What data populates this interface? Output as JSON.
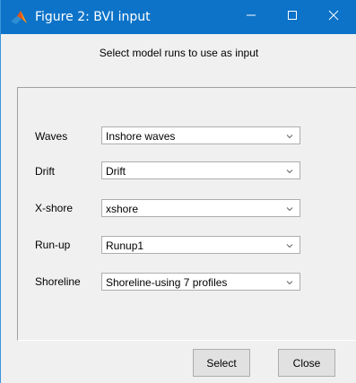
{
  "window": {
    "title": "Figure 2: BVI input"
  },
  "header": {
    "instruction": "Select model runs to use as input"
  },
  "rows": [
    {
      "label": "Waves",
      "value": "Inshore waves"
    },
    {
      "label": "Drift",
      "value": "Drift"
    },
    {
      "label": "X-shore",
      "value": "xshore"
    },
    {
      "label": "Run-up",
      "value": "Runup1"
    },
    {
      "label": "Shoreline",
      "value": "Shoreline-using 7 profiles"
    }
  ],
  "buttons": {
    "select_label": "Select",
    "close_label": "Close"
  },
  "colors": {
    "titlebar": "#0d73c8",
    "window_bg": "#f0f0f0",
    "button_bg": "#e1e1e1"
  },
  "icons": {
    "app": "matlab-icon",
    "minimize": "minimize-icon",
    "maximize": "maximize-icon",
    "close": "close-icon",
    "dropdown": "chevron-down-icon"
  }
}
